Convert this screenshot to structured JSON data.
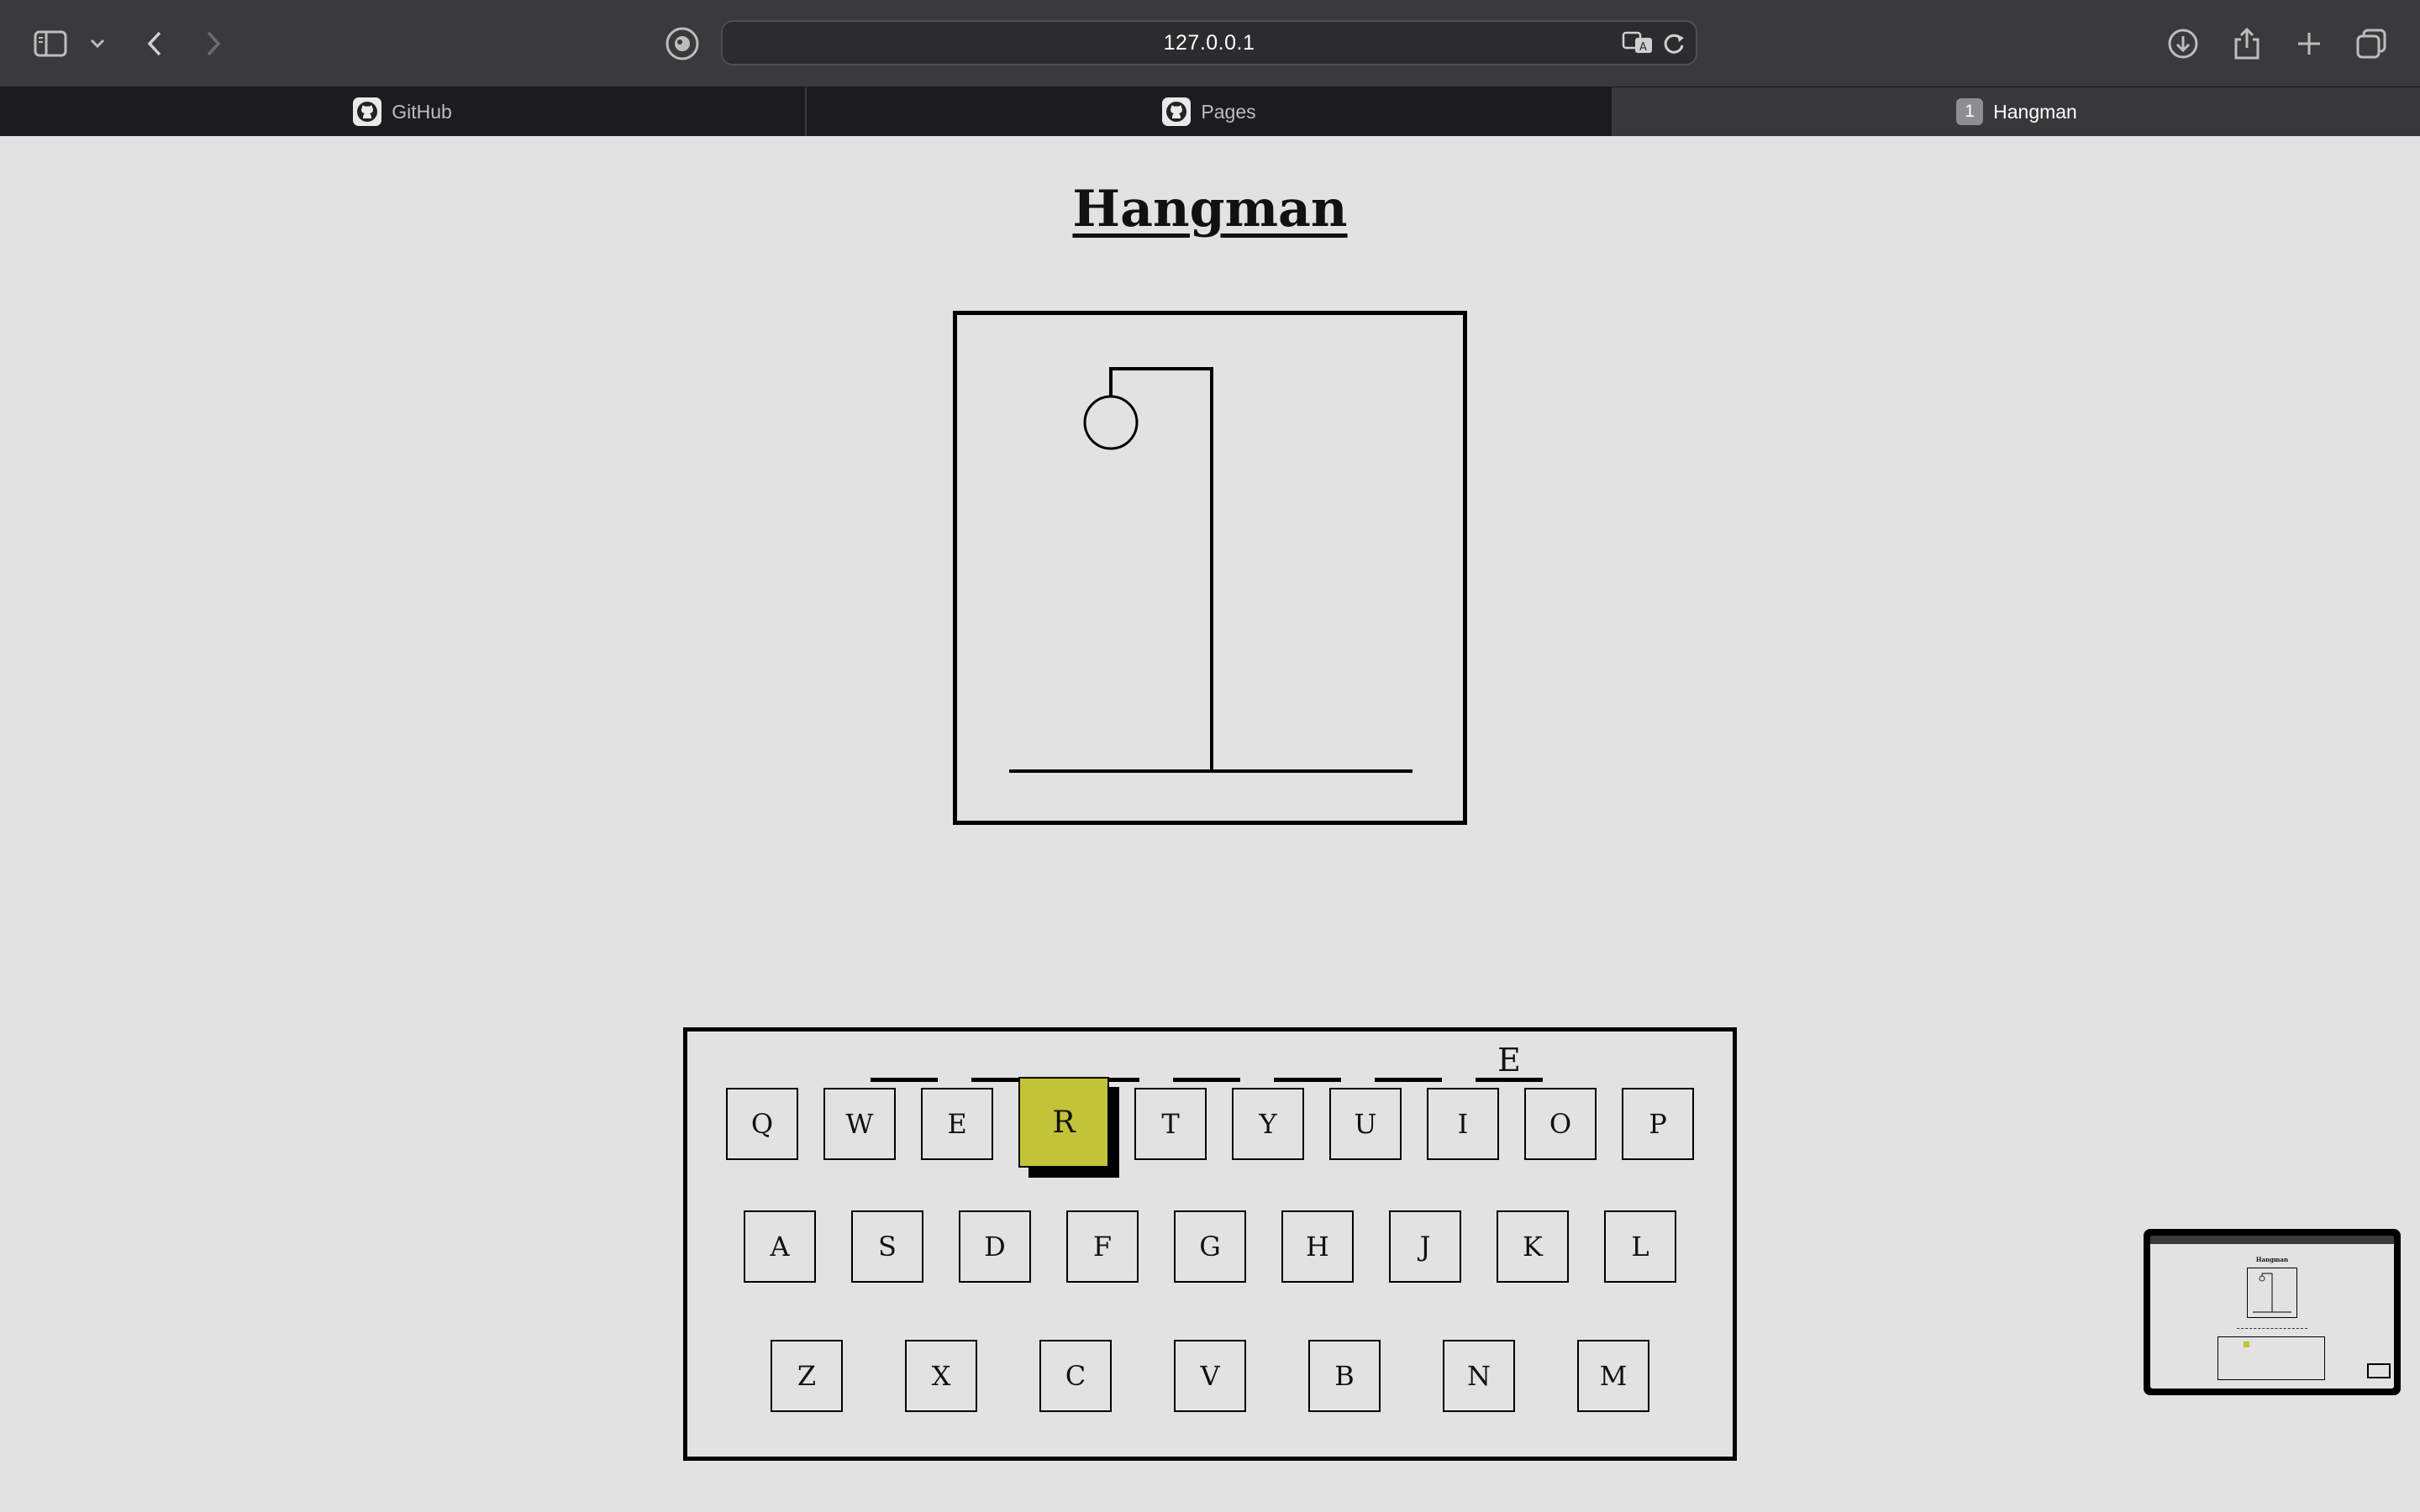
{
  "browser": {
    "url": "127.0.0.1",
    "tabs": [
      {
        "label": "GitHub",
        "icon": "github-icon"
      },
      {
        "label": "Pages",
        "icon": "github-icon"
      },
      {
        "label": "Hangman",
        "badge": "1",
        "active": true
      }
    ]
  },
  "page": {
    "title": "Hangman"
  },
  "game": {
    "word_slots": [
      "",
      "",
      "",
      "",
      "",
      "",
      "E"
    ],
    "keyboard_rows": [
      [
        "Q",
        "W",
        "E",
        "R",
        "T",
        "Y",
        "U",
        "I",
        "O",
        "P"
      ],
      [
        "A",
        "S",
        "D",
        "F",
        "G",
        "H",
        "J",
        "K",
        "L"
      ],
      [
        "Z",
        "X",
        "C",
        "V",
        "B",
        "N",
        "M"
      ]
    ],
    "selected_key": "R",
    "accent_color": "#c3c339"
  },
  "thumbnail": {
    "title": "Hangman"
  }
}
